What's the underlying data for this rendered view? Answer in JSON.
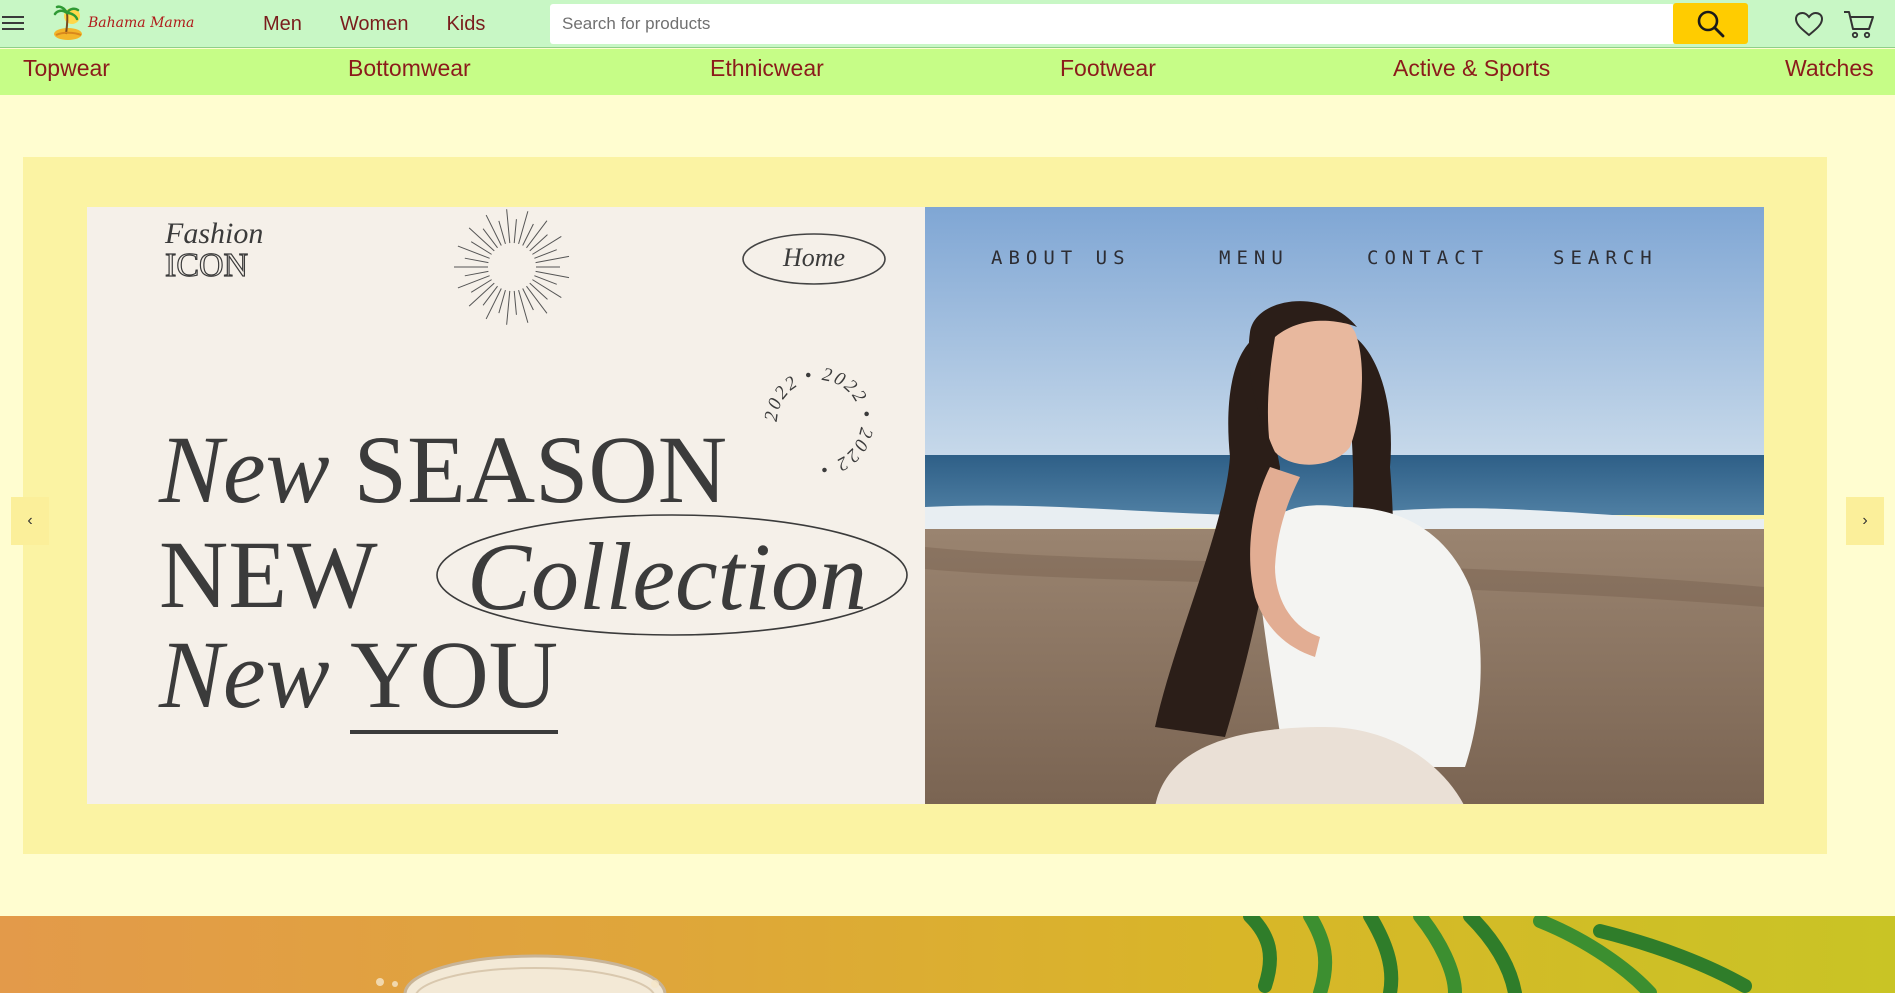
{
  "header": {
    "brand": "Bahama Mama",
    "nav": [
      "Men",
      "Women",
      "Kids"
    ],
    "search_placeholder": "Search for products"
  },
  "categories": [
    "Topwear",
    "Bottomwear",
    "Ethnicwear",
    "Footwear",
    "Active & Sports",
    "Watches"
  ],
  "banner": {
    "brand_line1": "Fashion",
    "brand_line2": "ICON",
    "home_label": "Home",
    "year_badge": "2022 • 2022 • 2022 •",
    "line1_italic": "New",
    "line1_caps": "SEASON",
    "line2_caps": "NEW",
    "line2_italic": "Collection",
    "line3_italic": "New",
    "line3_caps": "YOU",
    "menu": [
      "ABOUT US",
      "MENU",
      "CONTACT",
      "SEARCH"
    ]
  },
  "carousel": {
    "prev_label": "‹",
    "next_label": "›"
  },
  "icons": [
    "menu-icon",
    "logo-icon",
    "search-icon",
    "heart-icon",
    "cart-icon"
  ],
  "colors": {
    "header_bg": "#c8f7c5",
    "category_bg": "#c6fd87",
    "page_bg": "#fffdd0",
    "frame_bg": "#fbf3a3",
    "search_button": "#ffcc00",
    "link_text": "#8b1b1b"
  }
}
